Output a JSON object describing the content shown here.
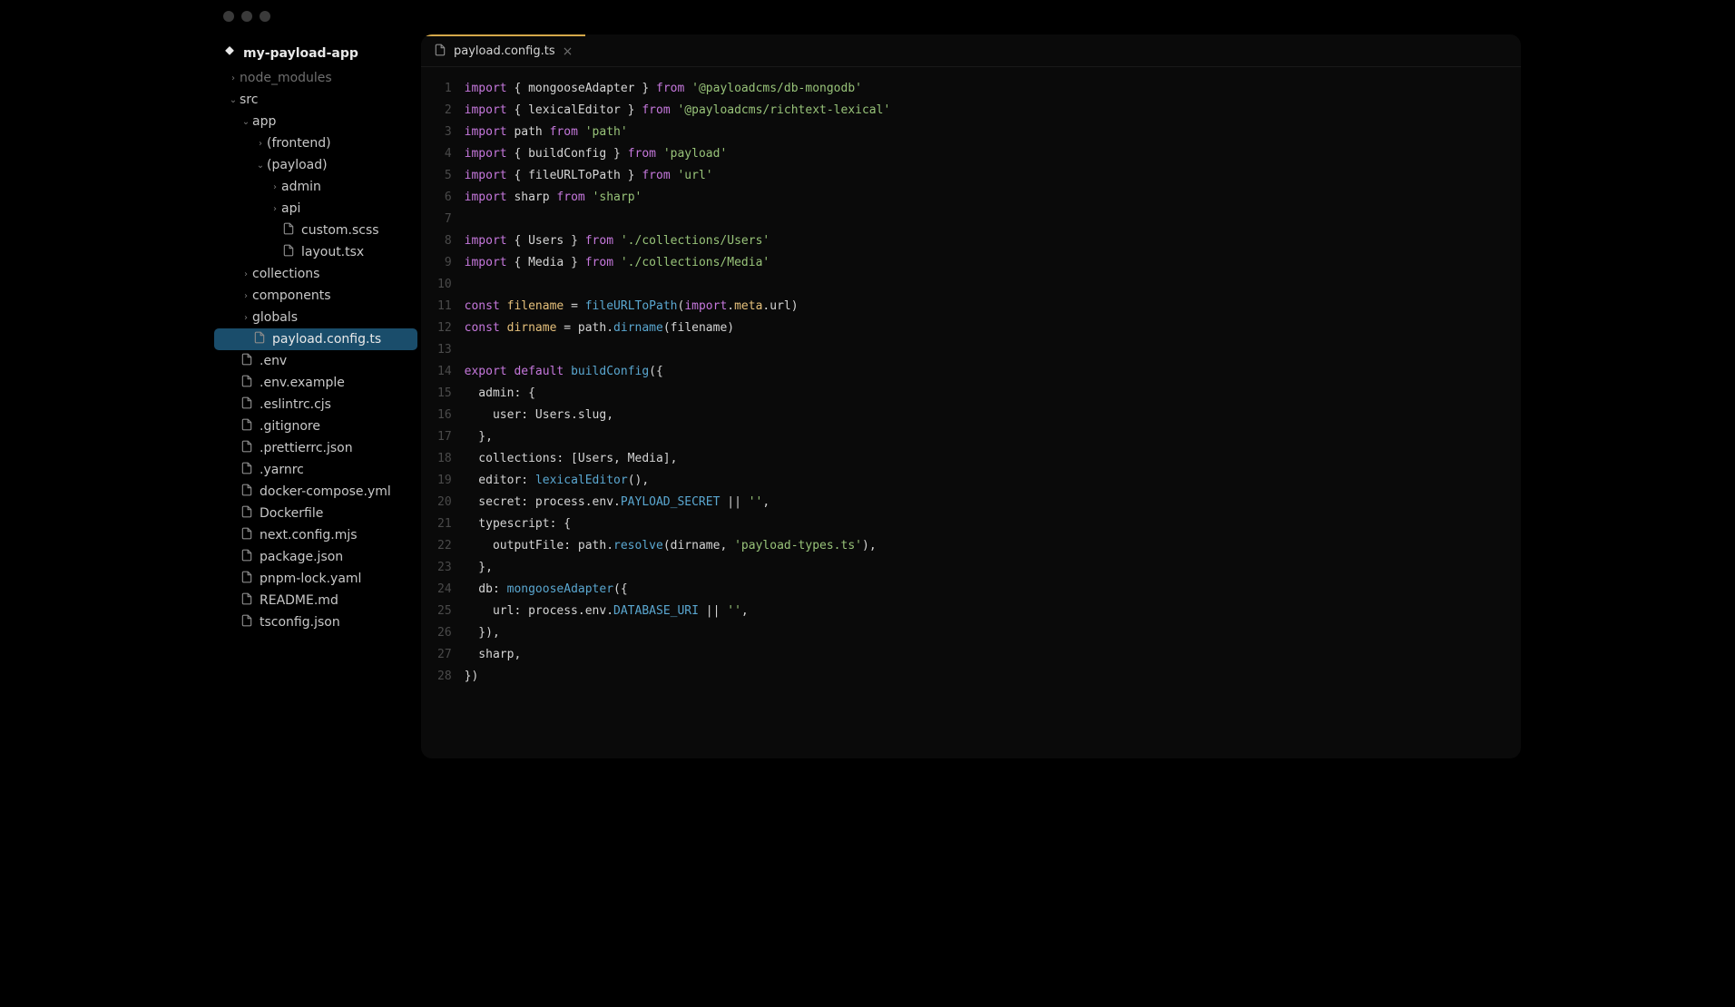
{
  "project": {
    "name": "my-payload-app"
  },
  "tabs": [
    {
      "label": "payload.config.ts"
    }
  ],
  "tree": [
    {
      "depth": 0,
      "type": "folder",
      "label": "node_modules",
      "expanded": false,
      "muted": true
    },
    {
      "depth": 0,
      "type": "folder",
      "label": "src",
      "expanded": true
    },
    {
      "depth": 1,
      "type": "folder",
      "label": "app",
      "expanded": true
    },
    {
      "depth": 2,
      "type": "folder",
      "label": "(frontend)",
      "expanded": false
    },
    {
      "depth": 2,
      "type": "folder",
      "label": "(payload)",
      "expanded": true
    },
    {
      "depth": 3,
      "type": "folder",
      "label": "admin",
      "expanded": false
    },
    {
      "depth": 3,
      "type": "folder",
      "label": "api",
      "expanded": false
    },
    {
      "depth": 3,
      "type": "file",
      "label": "custom.scss"
    },
    {
      "depth": 3,
      "type": "file",
      "label": "layout.tsx"
    },
    {
      "depth": 1,
      "type": "folder",
      "label": "collections",
      "expanded": false
    },
    {
      "depth": 1,
      "type": "folder",
      "label": "components",
      "expanded": false
    },
    {
      "depth": 1,
      "type": "folder",
      "label": "globals",
      "expanded": false
    },
    {
      "depth": 1,
      "type": "file",
      "label": "payload.config.ts",
      "selected": true
    },
    {
      "depth": 0,
      "type": "file",
      "label": ".env"
    },
    {
      "depth": 0,
      "type": "file",
      "label": ".env.example"
    },
    {
      "depth": 0,
      "type": "file",
      "label": ".eslintrc.cjs"
    },
    {
      "depth": 0,
      "type": "file",
      "label": ".gitignore"
    },
    {
      "depth": 0,
      "type": "file",
      "label": ".prettierrc.json"
    },
    {
      "depth": 0,
      "type": "file",
      "label": ".yarnrc"
    },
    {
      "depth": 0,
      "type": "file",
      "label": "docker-compose.yml"
    },
    {
      "depth": 0,
      "type": "file",
      "label": "Dockerfile"
    },
    {
      "depth": 0,
      "type": "file",
      "label": "next.config.mjs"
    },
    {
      "depth": 0,
      "type": "file",
      "label": "package.json"
    },
    {
      "depth": 0,
      "type": "file",
      "label": "pnpm-lock.yaml"
    },
    {
      "depth": 0,
      "type": "file",
      "label": "README.md"
    },
    {
      "depth": 0,
      "type": "file",
      "label": "tsconfig.json"
    }
  ],
  "code": {
    "lines": [
      [
        [
          "kw",
          "import"
        ],
        [
          "plain",
          " { mongooseAdapter } "
        ],
        [
          "kw",
          "from"
        ],
        [
          "plain",
          " "
        ],
        [
          "str",
          "'@payloadcms/db-mongodb'"
        ]
      ],
      [
        [
          "kw",
          "import"
        ],
        [
          "plain",
          " { lexicalEditor } "
        ],
        [
          "kw",
          "from"
        ],
        [
          "plain",
          " "
        ],
        [
          "str",
          "'@payloadcms/richtext-lexical'"
        ]
      ],
      [
        [
          "kw",
          "import"
        ],
        [
          "plain",
          " path "
        ],
        [
          "kw",
          "from"
        ],
        [
          "plain",
          " "
        ],
        [
          "str",
          "'path'"
        ]
      ],
      [
        [
          "kw",
          "import"
        ],
        [
          "plain",
          " { buildConfig } "
        ],
        [
          "kw",
          "from"
        ],
        [
          "plain",
          " "
        ],
        [
          "str",
          "'payload'"
        ]
      ],
      [
        [
          "kw",
          "import"
        ],
        [
          "plain",
          " { fileURLToPath } "
        ],
        [
          "kw",
          "from"
        ],
        [
          "plain",
          " "
        ],
        [
          "str",
          "'url'"
        ]
      ],
      [
        [
          "kw",
          "import"
        ],
        [
          "plain",
          " sharp "
        ],
        [
          "kw",
          "from"
        ],
        [
          "plain",
          " "
        ],
        [
          "str",
          "'sharp'"
        ]
      ],
      [
        [
          "plain",
          ""
        ]
      ],
      [
        [
          "kw",
          "import"
        ],
        [
          "plain",
          " { Users } "
        ],
        [
          "kw",
          "from"
        ],
        [
          "plain",
          " "
        ],
        [
          "str",
          "'./collections/Users'"
        ]
      ],
      [
        [
          "kw",
          "import"
        ],
        [
          "plain",
          " { Media } "
        ],
        [
          "kw",
          "from"
        ],
        [
          "plain",
          " "
        ],
        [
          "str",
          "'./collections/Media'"
        ]
      ],
      [
        [
          "plain",
          ""
        ]
      ],
      [
        [
          "const-kw",
          "const"
        ],
        [
          "plain",
          " "
        ],
        [
          "var",
          "filename"
        ],
        [
          "plain",
          " = "
        ],
        [
          "fn",
          "fileURLToPath"
        ],
        [
          "plain",
          "("
        ],
        [
          "kw",
          "import"
        ],
        [
          "plain",
          "."
        ],
        [
          "var",
          "meta"
        ],
        [
          "plain",
          ".url)"
        ]
      ],
      [
        [
          "const-kw",
          "const"
        ],
        [
          "plain",
          " "
        ],
        [
          "var",
          "dirname"
        ],
        [
          "plain",
          " = path."
        ],
        [
          "fn",
          "dirname"
        ],
        [
          "plain",
          "(filename)"
        ]
      ],
      [
        [
          "plain",
          ""
        ]
      ],
      [
        [
          "kw",
          "export"
        ],
        [
          "plain",
          " "
        ],
        [
          "kw",
          "default"
        ],
        [
          "plain",
          " "
        ],
        [
          "fn",
          "buildConfig"
        ],
        [
          "plain",
          "({"
        ]
      ],
      [
        [
          "plain",
          "  admin: {"
        ]
      ],
      [
        [
          "plain",
          "    user: Users.slug,"
        ]
      ],
      [
        [
          "plain",
          "  },"
        ]
      ],
      [
        [
          "plain",
          "  collections: [Users, Media],"
        ]
      ],
      [
        [
          "plain",
          "  editor: "
        ],
        [
          "fn",
          "lexicalEditor"
        ],
        [
          "plain",
          "(),"
        ]
      ],
      [
        [
          "plain",
          "  secret: process.env."
        ],
        [
          "prop",
          "PAYLOAD_SECRET"
        ],
        [
          "plain",
          " || "
        ],
        [
          "str",
          "''"
        ],
        [
          "plain",
          ","
        ]
      ],
      [
        [
          "plain",
          "  typescript: {"
        ]
      ],
      [
        [
          "plain",
          "    outputFile: path."
        ],
        [
          "fn",
          "resolve"
        ],
        [
          "plain",
          "(dirname, "
        ],
        [
          "str",
          "'payload-types.ts'"
        ],
        [
          "plain",
          "),"
        ]
      ],
      [
        [
          "plain",
          "  },"
        ]
      ],
      [
        [
          "plain",
          "  db: "
        ],
        [
          "fn",
          "mongooseAdapter"
        ],
        [
          "plain",
          "({"
        ]
      ],
      [
        [
          "plain",
          "    url: process.env."
        ],
        [
          "prop",
          "DATABASE_URI"
        ],
        [
          "plain",
          " || "
        ],
        [
          "str",
          "''"
        ],
        [
          "plain",
          ","
        ]
      ],
      [
        [
          "plain",
          "  }),"
        ]
      ],
      [
        [
          "plain",
          "  sharp,"
        ]
      ],
      [
        [
          "plain",
          "})"
        ]
      ]
    ]
  }
}
